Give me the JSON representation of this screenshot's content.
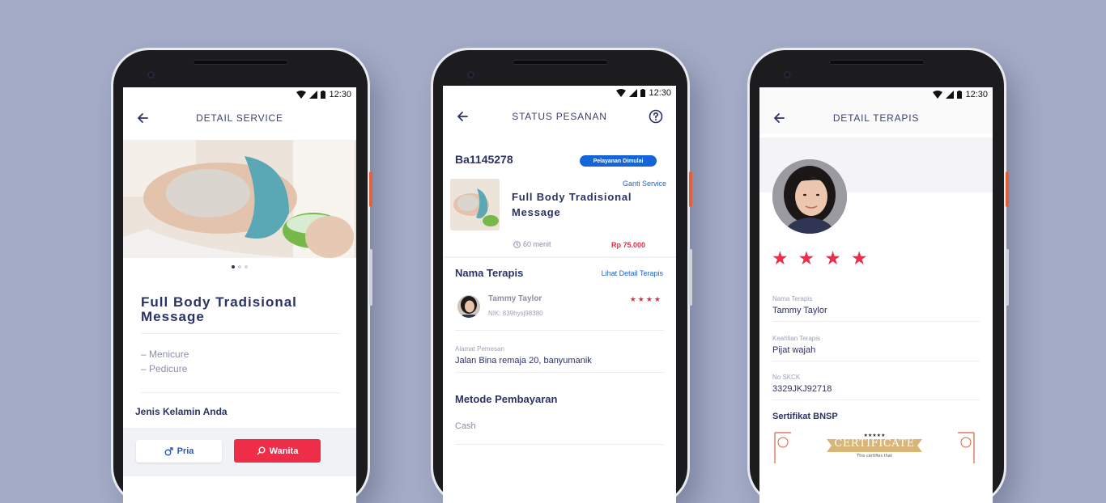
{
  "status_bar": {
    "time": "12:30"
  },
  "colors": {
    "background": "#a3abc6",
    "navy": "#2b3266",
    "accent_red": "#ee2e49",
    "badge_blue": "#1565d8",
    "link_blue": "#2462c9"
  },
  "detail_service": {
    "header": {
      "title": "DETAIL SERVICE",
      "back_icon": "arrow-left-icon"
    },
    "carousel": {
      "active_index": 0,
      "count": 3
    },
    "service_title": "Full Body Tradisional Message",
    "items": [
      "– Menicure",
      "– Pedicure"
    ],
    "gender_label": "Jenis Kelamin Anda",
    "gender_options": [
      {
        "label": "Pria",
        "icon": "male-icon",
        "selected": false
      },
      {
        "label": "Wanita",
        "icon": "female-icon",
        "selected": true
      }
    ]
  },
  "status_pesanan": {
    "header": {
      "title": "STATUS PESANAN",
      "back_icon": "arrow-left-icon",
      "help_icon": "help-circle-icon"
    },
    "order_id": "Ba1145278",
    "status_badge": "Pelayanan Dimulai",
    "change_service_link": "Ganti Service",
    "service_name": "Full Body Tradisional Message",
    "duration": "60 menit",
    "price": "Rp 75.000",
    "therapist_section_title": "Nama Terapis",
    "therapist_detail_link": "Lihat Detail Terapis",
    "therapist": {
      "name": "Tammy Taylor",
      "nik": "NIK: 839hysj98380",
      "rating": 4
    },
    "address_label": "Alamat Pemesan",
    "address_value": "Jalan Bina remaja 20, banyumanik",
    "payment_title": "Metode Pembayaran",
    "payment_method": "Cash"
  },
  "detail_terapis": {
    "header": {
      "title": "DETAIL TERAPIS",
      "back_icon": "arrow-left-icon"
    },
    "rating": 4,
    "fields": [
      {
        "label": "Nama Terapis",
        "value": "Tammy Taylor"
      },
      {
        "label": "Keahlian Terapis",
        "value": "Pijat wajah"
      },
      {
        "label": "No SKCK",
        "value": "3329JKJ92718"
      }
    ],
    "certificate_title": "Sertifikat BNSP",
    "certificate_banner": "CERTIFICATE",
    "certificate_subtext": "This certifies that"
  }
}
